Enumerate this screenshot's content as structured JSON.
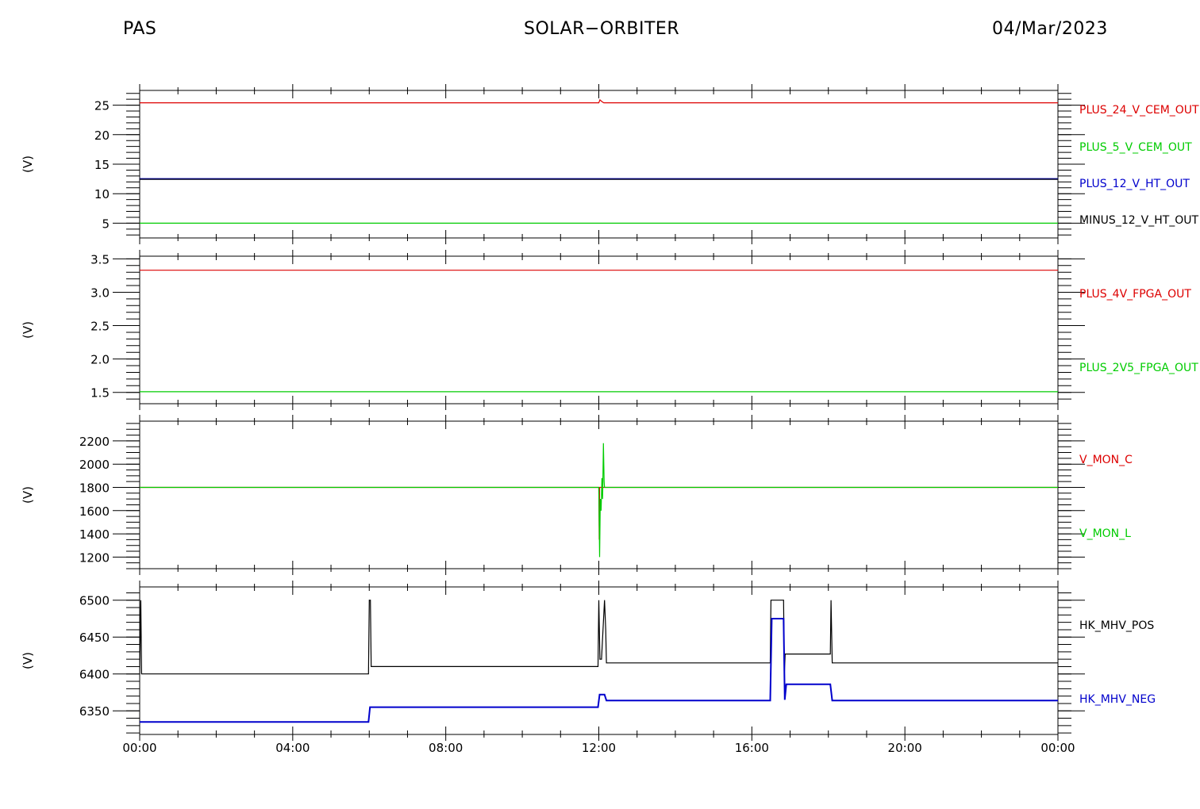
{
  "header": {
    "left": "PAS",
    "center": "SOLAR−ORBITER",
    "right": "04/Mar/2023"
  },
  "chart_data": [
    {
      "type": "line",
      "ylabel": "(V)",
      "ylim": [
        2.5,
        27.5
      ],
      "yticks": [
        5,
        10,
        15,
        20,
        25
      ],
      "yminor": 1,
      "xlim": [
        0,
        24
      ],
      "xticks": [
        "00:00",
        "04:00",
        "08:00",
        "12:00",
        "16:00",
        "20:00",
        "00:00"
      ],
      "series": [
        {
          "name": "PLUS_24_V_CEM_OUT",
          "color": "#dd0000",
          "x": [
            0,
            12.0,
            12.03,
            12.08,
            12.13,
            24
          ],
          "y": [
            25.4,
            25.4,
            25.9,
            25.6,
            25.4,
            25.4
          ]
        },
        {
          "name": "PLUS_5_V_CEM_OUT",
          "color": "#00cc00",
          "x": [
            0,
            24
          ],
          "y": [
            5.0,
            5.0
          ]
        },
        {
          "name": "PLUS_12_V_HT_OUT",
          "color": "#0000cc",
          "x": [
            0,
            24
          ],
          "y": [
            12.5,
            12.5
          ]
        },
        {
          "name": "MINUS_12_V_HT_OUT",
          "color": "#000000",
          "x": [
            0,
            24
          ],
          "y": [
            12.45,
            12.45
          ]
        }
      ],
      "legend": [
        {
          "text": "PLUS_24_V_CEM_OUT",
          "color": "#dd0000"
        },
        {
          "text": "PLUS_5_V_CEM_OUT",
          "color": "#00cc00"
        },
        {
          "text": "PLUS_12_V_HT_OUT",
          "color": "#0000cc"
        },
        {
          "text": "MINUS_12_V_HT_OUT",
          "color": "#000000"
        }
      ]
    },
    {
      "type": "line",
      "ylabel": "(V)",
      "ylim": [
        1.33,
        3.54
      ],
      "yticks": [
        "1.5",
        "2.0",
        "2.5",
        "3.0",
        "3.5"
      ],
      "yminor": 0.1,
      "xlim": [
        0,
        24
      ],
      "xticks": [
        "00:00",
        "04:00",
        "08:00",
        "12:00",
        "16:00",
        "20:00",
        "00:00"
      ],
      "series": [
        {
          "name": "PLUS_4V_FPGA_OUT",
          "color": "#dd0000",
          "x": [
            0,
            24
          ],
          "y": [
            3.33,
            3.33
          ]
        },
        {
          "name": "PLUS_2V5_FPGA_OUT",
          "color": "#00cc00",
          "x": [
            0,
            24
          ],
          "y": [
            1.51,
            1.51
          ]
        }
      ],
      "legend": [
        {
          "text": "PLUS_4V_FPGA_OUT",
          "color": "#dd0000"
        },
        {
          "text": "PLUS_2V5_FPGA_OUT",
          "color": "#00cc00"
        }
      ]
    },
    {
      "type": "line",
      "ylabel": "(V)",
      "ylim": [
        1100,
        2370
      ],
      "yticks": [
        1200,
        1400,
        1600,
        1800,
        2000,
        2200
      ],
      "yminor": 50,
      "xlim": [
        0,
        24
      ],
      "xticks": [
        "00:00",
        "04:00",
        "08:00",
        "12:00",
        "16:00",
        "20:00",
        "00:00"
      ],
      "series": [
        {
          "name": "V_MON_C",
          "color": "#dd0000",
          "x": [
            0,
            12.0,
            12.01,
            12.02,
            12.05,
            12.1,
            24
          ],
          "y": [
            1800,
            1800,
            1350,
            1800,
            1800,
            1800,
            1800
          ]
        },
        {
          "name": "V_MON_L",
          "color": "#00cc00",
          "x": [
            0,
            12.0,
            12.02,
            12.04,
            12.06,
            12.08,
            12.1,
            12.12,
            12.14,
            12.15,
            24
          ],
          "y": [
            1800,
            1800,
            1200,
            1700,
            1600,
            1880,
            1700,
            2180,
            1850,
            1800,
            1800
          ]
        }
      ],
      "legend": [
        {
          "text": "V_MON_C",
          "color": "#dd0000"
        },
        {
          "text": "V_MON_L",
          "color": "#00cc00"
        }
      ]
    },
    {
      "type": "line",
      "ylabel": "(V)",
      "ylim": [
        6318,
        6518
      ],
      "yticks": [
        6350,
        6400,
        6450,
        6500
      ],
      "yminor": 10,
      "xlim": [
        0,
        24
      ],
      "xticks": [
        "00:00",
        "04:00",
        "08:00",
        "12:00",
        "16:00",
        "20:00",
        "00:00"
      ],
      "series": [
        {
          "name": "HK_MHV_POS",
          "color": "#000000",
          "x": [
            0,
            0.03,
            0.05,
            5.98,
            6.0,
            6.03,
            6.05,
            11.98,
            12.0,
            12.03,
            12.07,
            12.15,
            12.18,
            12.2,
            16.48,
            16.5,
            16.52,
            16.83,
            16.85,
            16.87,
            16.9,
            18.05,
            18.07,
            18.1,
            24
          ],
          "y": [
            6400,
            6500,
            6400,
            6400,
            6500,
            6500,
            6410,
            6410,
            6500,
            6420,
            6420,
            6500,
            6460,
            6415,
            6415,
            6500,
            6500,
            6500,
            6400,
            6427,
            6427,
            6427,
            6500,
            6415,
            6415
          ]
        },
        {
          "name": "HK_MHV_NEG",
          "color": "#0000cc",
          "x": [
            0,
            0.05,
            5.98,
            6.02,
            11.98,
            12.02,
            12.15,
            12.2,
            16.48,
            16.52,
            16.83,
            16.86,
            16.9,
            18.05,
            18.1,
            24
          ],
          "y": [
            6335,
            6335,
            6335,
            6355,
            6355,
            6372,
            6372,
            6364,
            6364,
            6475,
            6475,
            6365,
            6386,
            6386,
            6364,
            6364
          ]
        }
      ],
      "legend": [
        {
          "text": "HK_MHV_POS",
          "color": "#000000"
        },
        {
          "text": "HK_MHV_NEG",
          "color": "#0000cc"
        }
      ]
    }
  ]
}
